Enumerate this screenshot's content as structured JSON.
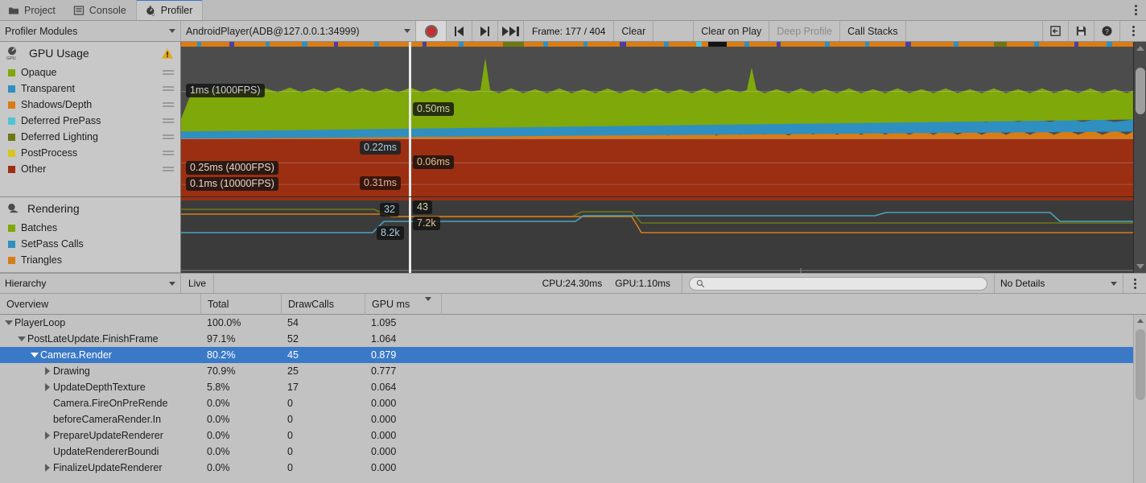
{
  "tabs": [
    {
      "label": "Project",
      "icon": "folder-icon",
      "active": false
    },
    {
      "label": "Console",
      "icon": "console-icon",
      "active": false
    },
    {
      "label": "Profiler",
      "icon": "stopwatch-icon",
      "active": true
    }
  ],
  "toolbar": {
    "modules_label": "Profiler Modules",
    "target_label": "AndroidPlayer(ADB@127.0.0.1:34999)",
    "record_icon": "record-icon",
    "prev_frame_icon": "step-first-icon",
    "next_frame_icon": "step-next-icon",
    "last_frame_icon": "step-last-icon",
    "frame_label": "Frame: 177 / 404",
    "clear_label": "Clear",
    "clear_on_play_label": "Clear on Play",
    "deep_profile_label": "Deep Profile",
    "call_stacks_label": "Call Stacks",
    "load_icon": "load-icon",
    "save_icon": "save-icon",
    "help_icon": "help-icon",
    "menu_icon": "kebab-menu-icon"
  },
  "modules": [
    {
      "title": "GPU Usage",
      "icon": "gpu-icon",
      "warning_icon": "warning-icon",
      "series": [
        {
          "label": "Opaque",
          "color": "#7fa80a"
        },
        {
          "label": "Transparent",
          "color": "#2f8fc0"
        },
        {
          "label": "Shadows/Depth",
          "color": "#d97c16"
        },
        {
          "label": "Deferred PrePass",
          "color": "#4ec4d4"
        },
        {
          "label": "Deferred Lighting",
          "color": "#6f7714"
        },
        {
          "label": "PostProcess",
          "color": "#d9c521"
        },
        {
          "label": "Other",
          "color": "#9c2f12"
        }
      ]
    },
    {
      "title": "Rendering",
      "icon": "rendering-icon",
      "series": [
        {
          "label": "Batches",
          "color": "#7fa80a"
        },
        {
          "label": "SetPass Calls",
          "color": "#2f8fc0"
        },
        {
          "label": "Triangles",
          "color": "#d97c16"
        }
      ]
    }
  ],
  "gpu_chart_labels": {
    "grid_1ms": "1ms (1000FPS)",
    "grid_025ms": "0.25ms (4000FPS)",
    "grid_01ms": "0.1ms (10000FPS)",
    "cursor_opaque": "0.50ms",
    "cursor_transparent": "0.22ms",
    "cursor_shadows": "0.06ms",
    "cursor_other": "0.31ms"
  },
  "rendering_chart_labels": {
    "left_setpass": "32",
    "left_triangles": "8.2k",
    "cursor_batches": "43",
    "cursor_triangles": "7.2k"
  },
  "hierarchy_bar": {
    "view_label": "Hierarchy",
    "live_label": "Live",
    "cpu_label": "CPU:24.30ms",
    "gpu_label": "GPU:1.10ms",
    "search_placeholder": "",
    "search_value": "",
    "search_icon": "search-icon",
    "details_label": "No Details",
    "menu_icon": "kebab-menu-icon"
  },
  "table": {
    "columns": [
      "Overview",
      "Total",
      "DrawCalls",
      "GPU ms"
    ],
    "sorted_column": "GPU ms",
    "rows": [
      {
        "name": "PlayerLoop",
        "indent": 0,
        "twisty": "down",
        "total": "100.0%",
        "drawcalls": "54",
        "gpums": "1.095",
        "selected": false
      },
      {
        "name": "PostLateUpdate.FinishFrame",
        "indent": 1,
        "twisty": "down",
        "total": "97.1%",
        "drawcalls": "52",
        "gpums": "1.064",
        "selected": false
      },
      {
        "name": "Camera.Render",
        "indent": 2,
        "twisty": "down",
        "total": "80.2%",
        "drawcalls": "45",
        "gpums": "0.879",
        "selected": true
      },
      {
        "name": "Drawing",
        "indent": 3,
        "twisty": "right",
        "total": "70.9%",
        "drawcalls": "25",
        "gpums": "0.777",
        "selected": false
      },
      {
        "name": "UpdateDepthTexture",
        "indent": 3,
        "twisty": "right",
        "total": "5.8%",
        "drawcalls": "17",
        "gpums": "0.064",
        "selected": false
      },
      {
        "name": "Camera.FireOnPreRende",
        "indent": 3,
        "twisty": "none",
        "total": "0.0%",
        "drawcalls": "0",
        "gpums": "0.000",
        "selected": false
      },
      {
        "name": "beforeCameraRender.In",
        "indent": 3,
        "twisty": "none",
        "total": "0.0%",
        "drawcalls": "0",
        "gpums": "0.000",
        "selected": false
      },
      {
        "name": "PrepareUpdateRenderer",
        "indent": 3,
        "twisty": "right",
        "total": "0.0%",
        "drawcalls": "0",
        "gpums": "0.000",
        "selected": false
      },
      {
        "name": "UpdateRendererBoundi",
        "indent": 3,
        "twisty": "none",
        "total": "0.0%",
        "drawcalls": "0",
        "gpums": "0.000",
        "selected": false
      },
      {
        "name": "FinalizeUpdateRenderer",
        "indent": 3,
        "twisty": "right",
        "total": "0.0%",
        "drawcalls": "0",
        "gpums": "0.000",
        "selected": false
      }
    ]
  },
  "chart_data": [
    {
      "type": "area",
      "title": "GPU Usage",
      "stacked": true,
      "ylabel": "ms",
      "gridlines": [
        {
          "value": 1.0,
          "label": "1ms (1000FPS)"
        },
        {
          "value": 0.25,
          "label": "0.25ms (4000FPS)"
        },
        {
          "value": 0.1,
          "label": "0.1ms (10000FPS)"
        }
      ],
      "cursor_frame": 177,
      "cursor_values": {
        "Opaque": 0.5,
        "Transparent": 0.22,
        "Shadows/Depth": 0.06,
        "Other": 0.31
      },
      "series": [
        {
          "name": "Other",
          "color": "#9c2f12",
          "values": [
            0.31,
            0.31,
            0.31,
            0.31,
            0.31,
            0.31,
            0.31,
            0.31,
            0.31,
            0.31,
            0.31,
            0.31,
            0.31,
            0.31,
            0.31,
            0.31,
            0.31,
            0.31,
            0.31,
            0.31,
            0.31,
            0.31,
            0.31,
            0.31,
            0.31,
            0.31,
            0.31,
            0.31,
            0.31,
            0.31,
            0.31,
            0.31,
            0.31,
            0.31,
            0.31,
            0.31,
            0.31,
            0.31,
            0.31,
            0.31
          ]
        },
        {
          "name": "Shadows/Depth",
          "color": "#d97c16",
          "values": [
            0.06,
            0.07,
            0.06,
            0.07,
            0.06,
            0.07,
            0.06,
            0.07,
            0.06,
            0.07,
            0.06,
            0.07,
            0.06,
            0.07,
            0.06,
            0.07,
            0.06,
            0.07,
            0.06,
            0.07,
            0.06,
            0.07,
            0.06,
            0.07,
            0.06,
            0.07,
            0.06,
            0.07,
            0.06,
            0.07,
            0.06,
            0.07,
            0.06,
            0.07,
            0.06,
            0.07,
            0.06,
            0.07,
            0.06,
            0.07
          ]
        },
        {
          "name": "Transparent",
          "color": "#2f8fc0",
          "values": [
            0.22,
            0.23,
            0.22,
            0.21,
            0.22,
            0.23,
            0.22,
            0.21,
            0.22,
            0.23,
            0.22,
            0.21,
            0.22,
            0.23,
            0.22,
            0.21,
            0.22,
            0.23,
            0.22,
            0.21,
            0.22,
            0.23,
            0.22,
            0.21,
            0.22,
            0.23,
            0.22,
            0.21,
            0.22,
            0.23,
            0.22,
            0.21,
            0.22,
            0.23,
            0.22,
            0.21,
            0.22,
            0.23,
            0.22,
            0.21
          ]
        },
        {
          "name": "Opaque",
          "color": "#7fa80a",
          "values": [
            0.5,
            0.52,
            0.5,
            0.49,
            0.51,
            0.5,
            0.52,
            0.5,
            0.49,
            0.51,
            0.5,
            0.52,
            0.5,
            0.49,
            0.51,
            0.5,
            0.52,
            0.5,
            0.49,
            0.51,
            0.5,
            0.52,
            0.5,
            0.49,
            0.51,
            0.5,
            0.52,
            0.5,
            0.49,
            0.51,
            0.5,
            0.52,
            0.5,
            0.49,
            0.51,
            0.5,
            0.52,
            0.5,
            0.49,
            0.51
          ]
        }
      ]
    },
    {
      "type": "line",
      "title": "Rendering",
      "cursor_frame": 177,
      "cursor_values": {
        "Batches": 43,
        "SetPass Calls": 32,
        "Triangles": 7200
      },
      "series": [
        {
          "name": "Batches",
          "color": "#7fa80a",
          "values": [
            54,
            54,
            54,
            54,
            54,
            54,
            54,
            54,
            54,
            54,
            48,
            48,
            48,
            48,
            48,
            48,
            48,
            48,
            43,
            43,
            43,
            43,
            43,
            43,
            43,
            43,
            43,
            43,
            43,
            43,
            43,
            43,
            43,
            43,
            43,
            43,
            43,
            43,
            43,
            43
          ]
        },
        {
          "name": "SetPass Calls",
          "color": "#2f8fc0",
          "values": [
            40,
            40,
            40,
            40,
            40,
            40,
            40,
            40,
            40,
            40,
            32,
            32,
            32,
            32,
            32,
            32,
            32,
            32,
            36,
            36,
            36,
            36,
            36,
            36,
            36,
            36,
            36,
            36,
            40,
            40,
            40,
            40,
            36,
            36,
            36,
            36,
            36,
            36,
            36,
            36
          ]
        },
        {
          "name": "Triangles",
          "color": "#d97c16",
          "values": [
            8200,
            8200,
            8200,
            8200,
            8200,
            8200,
            8200,
            8200,
            8200,
            8200,
            8200,
            8200,
            8200,
            8200,
            8200,
            8200,
            8200,
            8200,
            7200,
            7200,
            7200,
            7200,
            7200,
            7200,
            7200,
            7200,
            7200,
            7200,
            7200,
            7200,
            7200,
            7200,
            7200,
            7200,
            7200,
            7200,
            7200,
            7200,
            7200,
            7200
          ]
        }
      ]
    }
  ]
}
